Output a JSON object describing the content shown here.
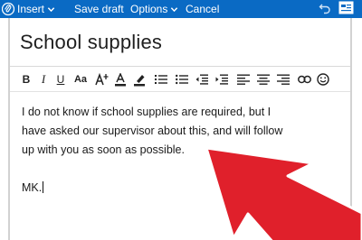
{
  "command_bar": {
    "insert_label": "Insert",
    "save_draft_label": "Save draft",
    "options_label": "Options",
    "cancel_label": "Cancel",
    "background_color": "#0a6ac4"
  },
  "message": {
    "subject": "School supplies",
    "body_lines": [
      "I do not know if school supplies are required, but I",
      "have asked our supervisor about this, and will follow",
      "up with you as soon as possible."
    ],
    "signature": "MK."
  },
  "format_toolbar": {
    "bold_label": "B",
    "italic_label": "I",
    "underline_label": "U",
    "font_size_label": "Aa",
    "icons": [
      "font-grow-icon",
      "font-color-icon",
      "highlight-icon",
      "numbered-list-icon",
      "bulleted-list-icon",
      "decrease-indent-icon",
      "increase-indent-icon",
      "align-left-icon",
      "align-center-icon",
      "align-right-icon",
      "link-icon",
      "emoji-icon"
    ]
  },
  "annotation": {
    "arrow_color": "#e0202b",
    "arrow_outline_color": "#ffffff"
  }
}
